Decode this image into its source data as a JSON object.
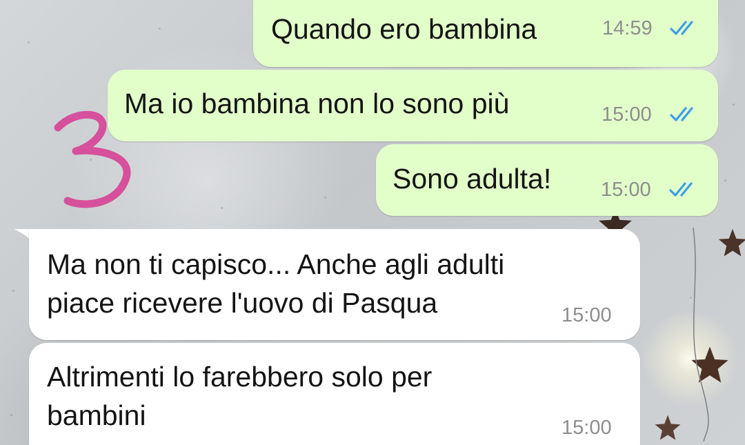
{
  "messages": [
    {
      "direction": "outgoing",
      "text": "Quando ero bambina",
      "time": "14:59",
      "status": "read"
    },
    {
      "direction": "outgoing",
      "text": "Ma io bambina non lo sono più",
      "time": "15:00",
      "status": "read"
    },
    {
      "direction": "outgoing",
      "text": "Sono adulta!",
      "time": "15:00",
      "status": "read"
    },
    {
      "direction": "incoming",
      "lines": [
        "Ma non ti capisco... Anche agli adulti",
        "piace ricevere l'uovo di Pasqua"
      ],
      "time": "15:00"
    },
    {
      "direction": "incoming",
      "lines": [
        "Altrimenti lo farebbero solo per",
        "bambini"
      ],
      "time": "15:00"
    }
  ],
  "annotation": {
    "text": "3",
    "color": "#d6509c"
  },
  "colors": {
    "outgoing_bubble": "#e2ffc9",
    "incoming_bubble": "#ffffff",
    "read_ticks": "#3a9ee8",
    "timestamp": "#8d8d8d"
  },
  "icons": {
    "read_receipt": "double-check-icon",
    "wallpaper_decoration": "star-icon"
  }
}
